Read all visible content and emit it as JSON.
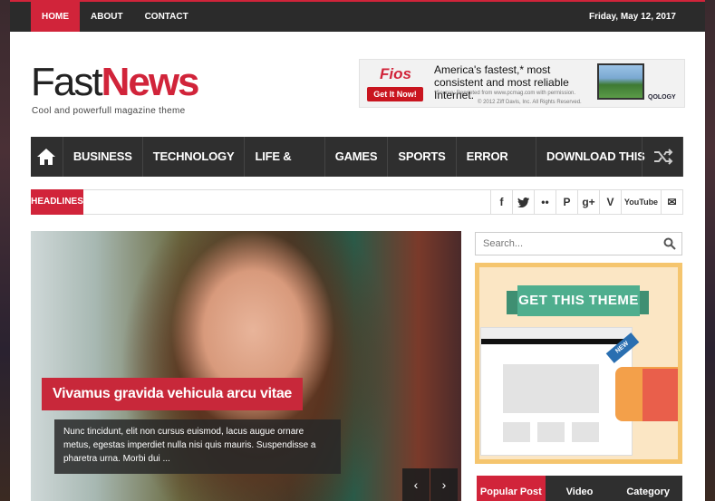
{
  "topbar": {
    "nav": [
      "HOME",
      "ABOUT",
      "CONTACT"
    ],
    "date": "Friday, May 12, 2017"
  },
  "logo": {
    "part1": "Fast",
    "part2": "News",
    "tagline": "Cool  and powerfull  magazine theme"
  },
  "ad": {
    "brand": "Fios",
    "button": "Get It Now!",
    "headline": "America's fastest,* most consistent and most reliable Internet.",
    "source": "*Source: Reprinted from www.pcmag.com with permission.",
    "copyright": "© 2012 Ziff Davis, Inc. All Rights Reserved.",
    "partner": "QOLOGY"
  },
  "mainnav": [
    "BUSINESS",
    "TECHNOLOGY",
    "LIFE & STYLE",
    "GAMES",
    "SPORTS",
    "ERROR PAGE",
    "DOWNLOAD THIS TEMPLATE"
  ],
  "headlines": {
    "label": "HEADLINES"
  },
  "social": [
    "f",
    "t",
    "••",
    "P",
    "g+",
    "V",
    "YouTube",
    "✉"
  ],
  "hero": {
    "title": "Vivamus gravida vehicula arcu vitae",
    "excerpt": "Nunc tincidunt, elit non cursus euismod, lacus augue ornare metus, egestas imperdiet nulla nisi quis mauris. Suspendisse a pharetra urna. Morbi dui ...",
    "prev": "‹",
    "next": "›"
  },
  "search": {
    "placeholder": "Search..."
  },
  "promo": {
    "title": "GET THIS THEME",
    "tag": "NEW"
  },
  "tabs": [
    "Popular Post",
    "Video",
    "Category"
  ],
  "colors": {
    "accent": "#d1243a",
    "dark": "#2f2f2f"
  }
}
